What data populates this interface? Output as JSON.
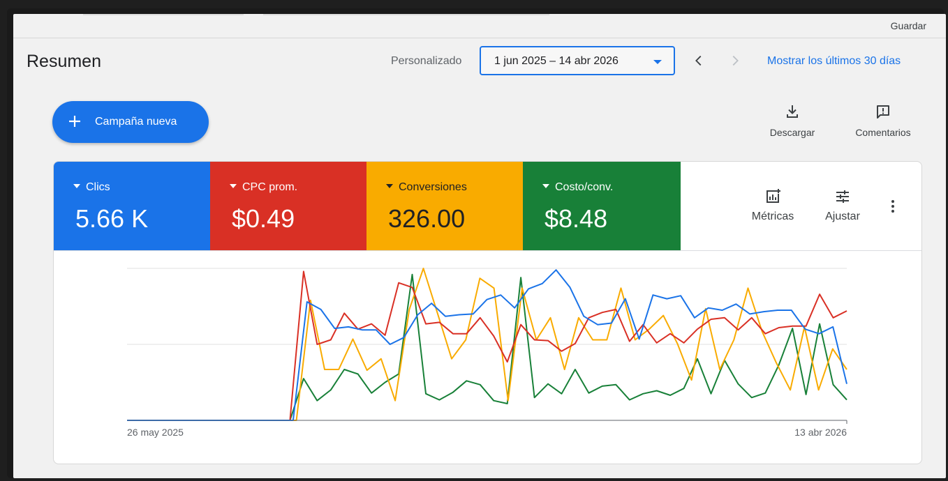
{
  "toolbar": {
    "save_label": "Guardar"
  },
  "header": {
    "title": "Resumen",
    "range_type": "Personalizado",
    "date_range": "1 jun 2025 – 14 abr 2026",
    "show_last_30": "Mostrar los últimos 30 días"
  },
  "actions": {
    "new_campaign": "Campaña nueva",
    "download": "Descargar",
    "feedback": "Comentarios"
  },
  "scorecards": [
    {
      "label": "Clics",
      "value": "5.66 K",
      "color": "#1a73e8"
    },
    {
      "label": "CPC prom.",
      "value": "$0.49",
      "color": "#d93025"
    },
    {
      "label": "Conversiones",
      "value": "326.00",
      "color": "#f9ab00"
    },
    {
      "label": "Costo/conv.",
      "value": "$8.48",
      "color": "#188038"
    }
  ],
  "card_tools": {
    "metrics": "Métricas",
    "adjust": "Ajustar"
  },
  "chart_data": {
    "type": "line",
    "x_labels": [
      "26 may 2025",
      "13 abr 2026"
    ],
    "grid": true,
    "ylim": [
      0,
      2
    ],
    "series": [
      {
        "color": "#1a73e8",
        "values": [
          0,
          0,
          0,
          0,
          0,
          0,
          0,
          0,
          0,
          0,
          0,
          0,
          0,
          1.56,
          1.46,
          1.21,
          1.23,
          1.19,
          1.19,
          1.0,
          1.09,
          1.39,
          1.54,
          1.37,
          1.39,
          1.4,
          1.59,
          1.65,
          1.48,
          1.73,
          1.8,
          1.98,
          1.75,
          1.37,
          1.26,
          1.28,
          1.6,
          1.07,
          1.65,
          1.6,
          1.64,
          1.35,
          1.48,
          1.45,
          1.53,
          1.4,
          1.43,
          1.45,
          1.45,
          1.2,
          1.14,
          1.23,
          0.48
        ]
      },
      {
        "color": "#d93025",
        "values": [
          0,
          0,
          0,
          0,
          0,
          0,
          0,
          0,
          0,
          0,
          0,
          0,
          0,
          1.96,
          1.0,
          1.06,
          1.41,
          1.2,
          1.27,
          1.12,
          1.81,
          1.75,
          1.27,
          1.29,
          1.14,
          1.14,
          1.35,
          1.11,
          0.77,
          1.26,
          1.06,
          1.05,
          0.91,
          1.01,
          1.35,
          1.42,
          1.46,
          1.04,
          1.26,
          1.02,
          1.14,
          1.02,
          1.2,
          1.33,
          1.35,
          1.19,
          1.35,
          1.14,
          1.22,
          1.24,
          1.24,
          1.66,
          1.35,
          1.44
        ]
      },
      {
        "color": "#f9ab00",
        "values": [
          0,
          0,
          0,
          0,
          0,
          0,
          0,
          0,
          0,
          0,
          0,
          0,
          0,
          1.58,
          0.67,
          0.67,
          1.07,
          0.66,
          0.81,
          0.26,
          1.46,
          2.0,
          1.41,
          0.81,
          1.06,
          1.87,
          1.74,
          0.26,
          1.74,
          1.06,
          1.35,
          0.67,
          1.35,
          1.06,
          1.06,
          1.74,
          1.06,
          1.2,
          1.38,
          1.01,
          0.53,
          1.47,
          0.67,
          1.06,
          1.74,
          1.17,
          0.76,
          0.4,
          1.23,
          0.4,
          0.94,
          0.67
        ]
      },
      {
        "color": "#188038",
        "values": [
          0,
          0,
          0,
          0,
          0,
          0,
          0,
          0,
          0,
          0,
          0,
          0,
          0,
          0.55,
          0.26,
          0.4,
          0.67,
          0.61,
          0.36,
          0.5,
          0.61,
          1.92,
          0.35,
          0.27,
          0.37,
          0.52,
          0.47,
          0.26,
          0.22,
          1.88,
          0.3,
          0.48,
          0.35,
          0.67,
          0.36,
          0.45,
          0.47,
          0.27,
          0.35,
          0.39,
          0.33,
          0.42,
          0.81,
          0.35,
          0.79,
          0.48,
          0.3,
          0.36,
          0.73,
          1.21,
          0.34,
          1.27,
          0.47,
          0.27
        ]
      }
    ]
  }
}
